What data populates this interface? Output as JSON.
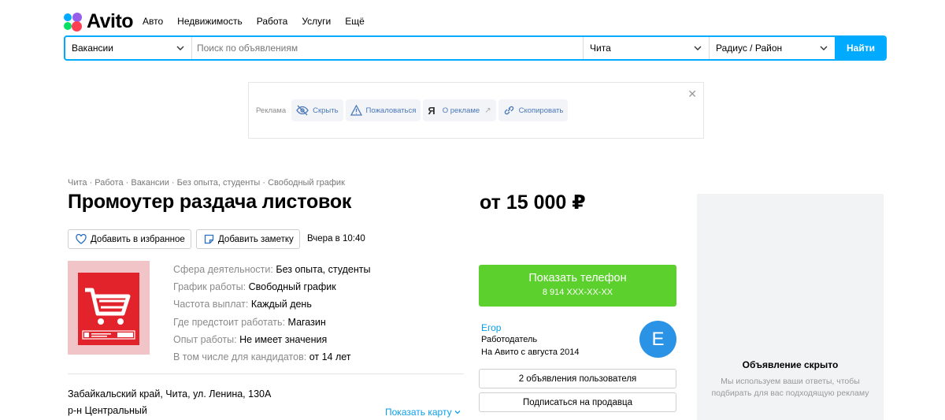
{
  "header": {
    "logo_text": "Avito",
    "nav": [
      "Авто",
      "Недвижимость",
      "Работа",
      "Услуги",
      "Ещё"
    ]
  },
  "search": {
    "category": "Вакансии",
    "placeholder": "Поиск по объявлениям",
    "city": "Чита",
    "radius": "Радиус / Район",
    "submit_label": "Найти"
  },
  "ad": {
    "label": "Реклама",
    "hide": "Скрыть",
    "complain": "Пожаловаться",
    "about": "О рекламе",
    "copy": "Скопировать"
  },
  "listing": {
    "breadcrumb": "Чита · Работа · Вакансии · Без опыта, студенты · Свободный график",
    "title": "Промоутер раздача листовок",
    "price": "от 15 000 ₽",
    "favorite_label": "Добавить в избранное",
    "note_label": "Добавить заметку",
    "posted": "Вчера в 10:40",
    "params": [
      {
        "key": "Сфера деятельности:",
        "value": "Без опыта, студенты"
      },
      {
        "key": "График работы:",
        "value": "Свободный график"
      },
      {
        "key": "Частота выплат:",
        "value": "Каждый день"
      },
      {
        "key": "Где предстоит работать:",
        "value": "Магазин"
      },
      {
        "key": "Опыт работы:",
        "value": "Не имеет значения"
      },
      {
        "key": "В том числе для кандидатов:",
        "value": "от 14 лет"
      }
    ],
    "address": "Забайкальский край, Чита, ул. Ленина, 130А",
    "district": "р-н Центральный",
    "show_map": "Показать карту"
  },
  "seller": {
    "phone_button": "Показать телефон",
    "phone_masked": "8 914 XXX-XX-XX",
    "name": "Егор",
    "role": "Работодатель",
    "since": "На Авито с августа 2014",
    "avatar_letter": "E",
    "user_ads": "2 объявления пользователя",
    "subscribe": "Подписаться на продавца"
  },
  "hidden_ad": {
    "title": "Объявление скрыто",
    "text": "Мы используем ваши ответы, чтобы подбирать для вас подходящую рекламу"
  },
  "colors": {
    "accent": "#00aaff",
    "phone_button": "#5cd02c",
    "link": "#0a9ee8",
    "avatar": "#2a93e6"
  }
}
